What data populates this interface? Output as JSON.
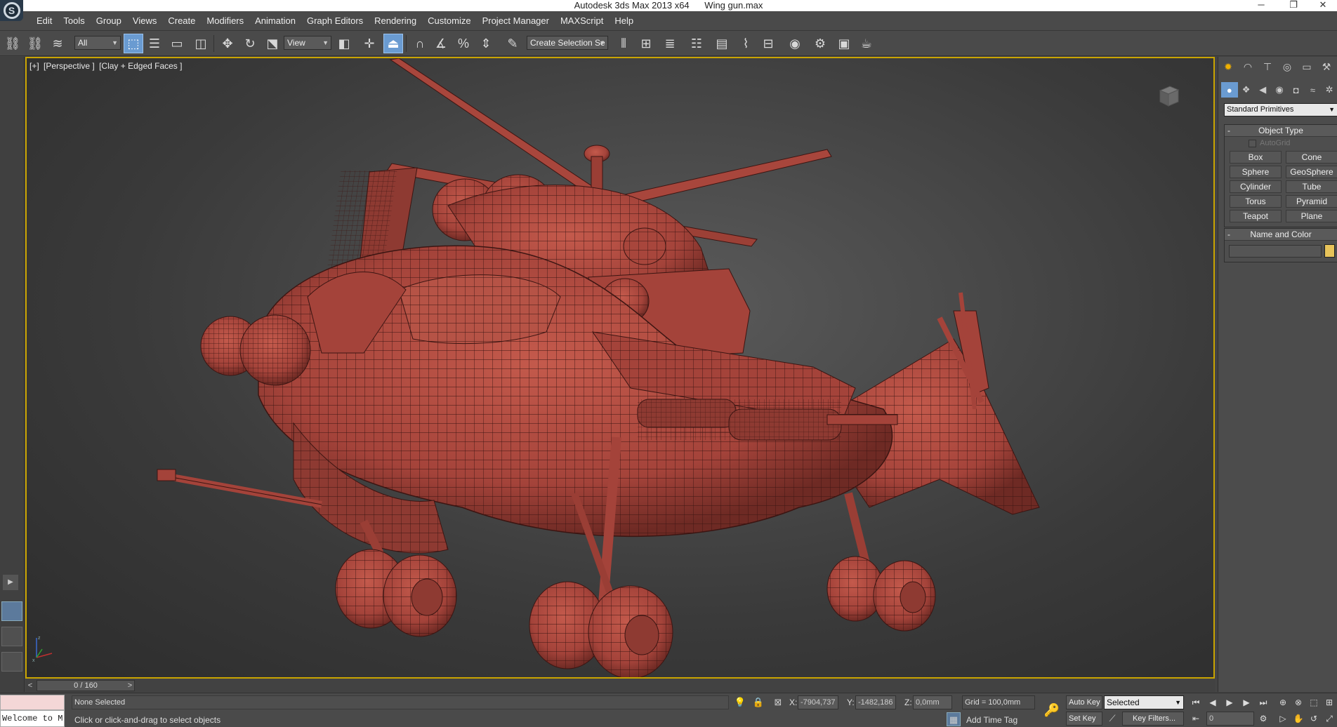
{
  "window": {
    "app_title": "Autodesk 3ds Max  2013 x64",
    "file_name": "Wing gun.max",
    "minimize": "─",
    "restore": "❐",
    "close": "✕",
    "logo_glyph": "S"
  },
  "menubar": {
    "items": [
      "Edit",
      "Tools",
      "Group",
      "Views",
      "Create",
      "Modifiers",
      "Animation",
      "Graph Editors",
      "Rendering",
      "Customize",
      "Project Manager",
      "MAXScript",
      "Help"
    ]
  },
  "toolbar": {
    "selection_filter": "All",
    "reference_coordinate": "View",
    "named_selection_sets": "Create Selection Se",
    "icons": [
      "select-and-link-icon",
      "unlink-selection-icon",
      "bind-to-space-warp-icon",
      "select-object-icon",
      "select-by-name-icon",
      "rectangular-selection-region-icon",
      "window-crossing-icon",
      "select-and-move-icon",
      "select-and-rotate-icon",
      "select-and-scale-icon",
      "use-pivot-center-icon",
      "select-and-manipulate-icon",
      "keyboard-shortcut-override-icon",
      "snaps-toggle-icon",
      "angle-snap-icon",
      "percent-snap-icon",
      "spinner-snap-icon",
      "edit-named-selection-sets-icon",
      "mirror-icon",
      "align-icon",
      "scene-explorer-icon",
      "layer-manager-icon",
      "graphite-ribbon-icon",
      "curve-editor-icon",
      "schematic-view-icon",
      "material-editor-icon",
      "render-setup-icon",
      "rendered-frame-window-icon",
      "render-production-icon"
    ]
  },
  "viewport": {
    "labels": [
      "[+]",
      "[Perspective ]",
      "[Clay + Edged Faces ]"
    ],
    "border_color": "#c9a400",
    "model_color": "#b84c3f",
    "wire_color": "#3b1512"
  },
  "command_panel": {
    "tabs": [
      "create-tab-icon",
      "modify-tab-icon",
      "hierarchy-tab-icon",
      "motion-tab-icon",
      "display-tab-icon",
      "utilities-tab-icon"
    ],
    "subtabs": [
      "geometry-icon",
      "shapes-icon",
      "lights-icon",
      "cameras-icon",
      "helpers-icon",
      "space-warps-icon",
      "systems-icon"
    ],
    "category": "Standard Primitives",
    "object_type": {
      "title": "Object Type",
      "autogrid": "AutoGrid",
      "buttons": [
        "Box",
        "Cone",
        "Sphere",
        "GeoSphere",
        "Cylinder",
        "Tube",
        "Torus",
        "Pyramid",
        "Teapot",
        "Plane"
      ]
    },
    "name_and_color": {
      "title": "Name and Color",
      "name_value": "",
      "swatch_color": "#e7c35a"
    }
  },
  "timeslider": {
    "frame_display": "0 / 160",
    "prev": "<",
    "next": ">"
  },
  "statusbar": {
    "selection_status": "None Selected",
    "prompt": "Click or click-and-drag to select objects",
    "maxscript_output": "Welcome to M",
    "x_label": "X:",
    "x_value": "-7904,737",
    "y_label": "Y:",
    "y_value": "-1482,186",
    "z_label": "Z:",
    "z_value": "0,0mm",
    "grid": "Grid = 100,0mm",
    "add_time_tag": "Add Time Tag",
    "auto_key": "Auto Key",
    "set_key": "Set Key",
    "key_mode": "Selected",
    "key_filters": "Key Filters...",
    "current_frame": "0"
  }
}
